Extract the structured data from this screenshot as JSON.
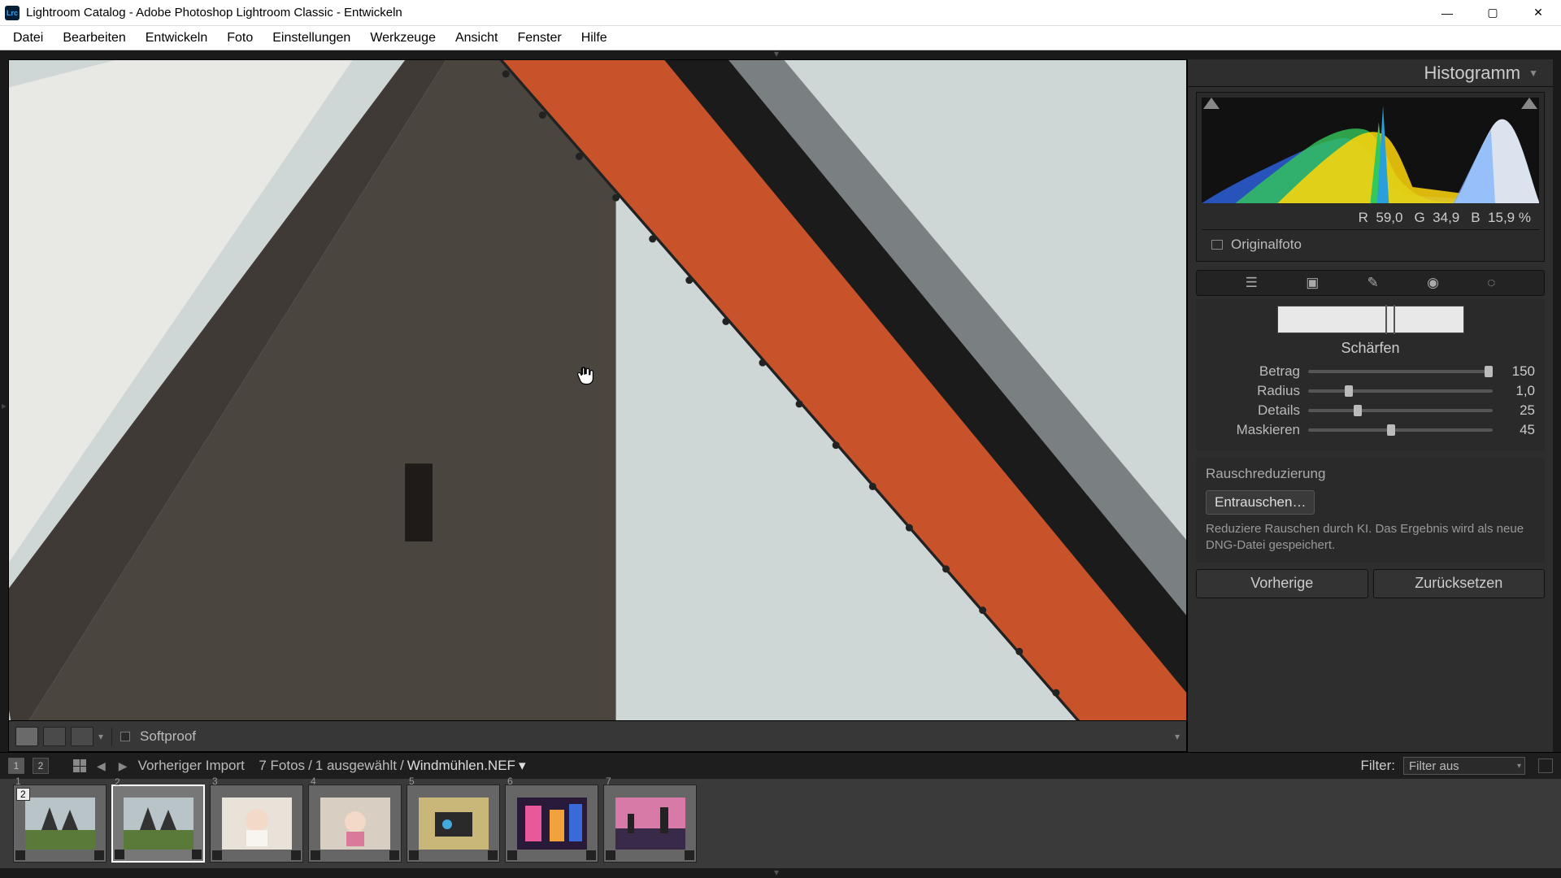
{
  "title": "Lightroom Catalog - Adobe Photoshop Lightroom Classic - Entwickeln",
  "app_icon_text": "Lrc",
  "menu": [
    "Datei",
    "Bearbeiten",
    "Entwickeln",
    "Foto",
    "Einstellungen",
    "Werkzeuge",
    "Ansicht",
    "Fenster",
    "Hilfe"
  ],
  "toolbar": {
    "softproof": "Softproof"
  },
  "histogram": {
    "title": "Histogramm",
    "rgb": {
      "r_label": "R",
      "r_val": "59,0",
      "g_label": "G",
      "g_val": "34,9",
      "b_label": "B",
      "b_val": "15,9",
      "pct": "%"
    },
    "original": "Originalfoto"
  },
  "sharpen": {
    "title": "Schärfen",
    "betrag": {
      "label": "Betrag",
      "value": "150",
      "pos": 98
    },
    "radius": {
      "label": "Radius",
      "value": "1,0",
      "pos": 22
    },
    "details": {
      "label": "Details",
      "value": "25",
      "pos": 27
    },
    "maskieren": {
      "label": "Maskieren",
      "value": "45",
      "pos": 45
    }
  },
  "noise": {
    "title": "Rauschreduzierung",
    "button": "Entrauschen…",
    "desc": "Reduziere Rauschen durch KI. Das Ergebnis wird als neue DNG-Datei gespeichert."
  },
  "bottom_buttons": {
    "prev": "Vorherige",
    "reset": "Zurücksetzen"
  },
  "filmstrip_header": {
    "mon1": "1",
    "mon2": "2",
    "prev_import": "Vorheriger Import",
    "count": "7 Fotos",
    "selected": "1 ausgewählt",
    "filename": "Windmühlen.NEF",
    "filter_label": "Filter:",
    "filter_value": "Filter aus"
  },
  "thumbs": [
    {
      "n": "1",
      "badge": "2"
    },
    {
      "n": "2"
    },
    {
      "n": "3"
    },
    {
      "n": "4"
    },
    {
      "n": "5"
    },
    {
      "n": "6"
    },
    {
      "n": "7"
    }
  ]
}
